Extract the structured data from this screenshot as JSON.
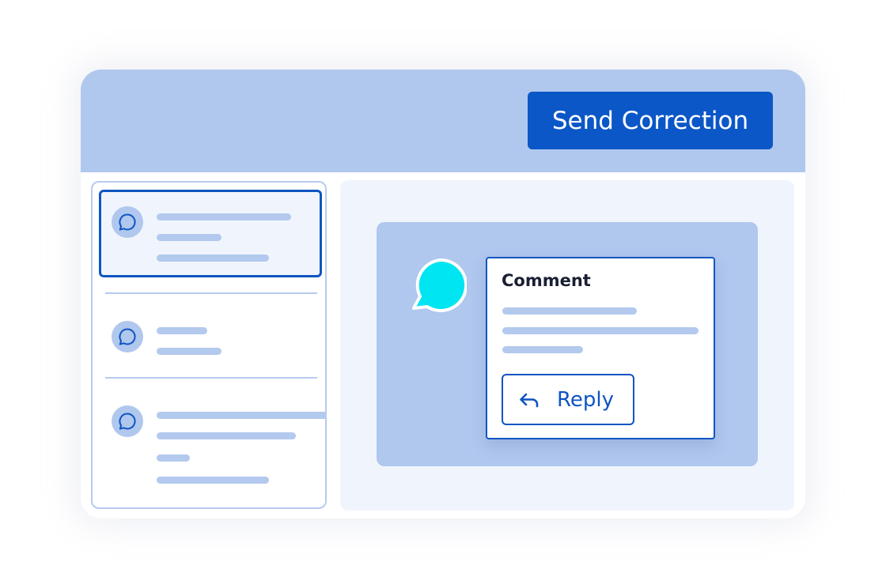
{
  "header": {
    "send_label": "Send Correction"
  },
  "comment_card": {
    "title": "Comment",
    "reply_label": "Reply"
  },
  "sidebar": {
    "item_count": 3,
    "selected_index": 0
  },
  "icons": {
    "list_item": "chat-bubble-icon",
    "comment_marker": "chat-bubble-icon",
    "reply": "reply-arrow-icon"
  },
  "colors": {
    "accent": "#0b57c7",
    "header_bg": "#b1c8ee",
    "panel_bg": "#f0f5fd",
    "bubble": "#00e5f2",
    "placeholder_line": "#b3c9ee"
  }
}
